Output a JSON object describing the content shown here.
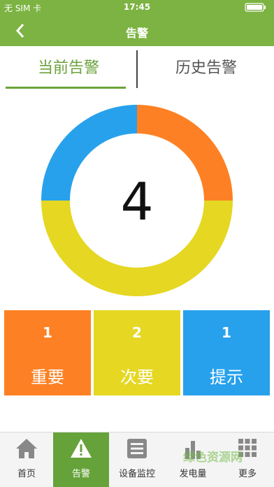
{
  "status_bar": {
    "carrier": "无 SIM 卡",
    "time": "17:45"
  },
  "header": {
    "back_icon": "chevron-left-icon",
    "title": "告警"
  },
  "tabs": [
    {
      "label": "当前告警",
      "active": true
    },
    {
      "label": "历史告警",
      "active": false
    }
  ],
  "summary": {
    "total": "4",
    "segments": [
      {
        "name": "重要",
        "value": 1,
        "color": "#fd8124"
      },
      {
        "name": "次要",
        "value": 2,
        "color": "#e5d722"
      },
      {
        "name": "提示",
        "value": 1,
        "color": "#27a1ec"
      }
    ]
  },
  "cards": [
    {
      "count": "1",
      "label": "重要",
      "color": "#fd8124"
    },
    {
      "count": "2",
      "label": "次要",
      "color": "#e5d722"
    },
    {
      "count": "1",
      "label": "提示",
      "color": "#27a1ec"
    }
  ],
  "tabbar": [
    {
      "label": "首页",
      "icon": "home-icon",
      "active": false
    },
    {
      "label": "告警",
      "icon": "warning-icon",
      "active": true
    },
    {
      "label": "设备监控",
      "icon": "list-icon",
      "active": false
    },
    {
      "label": "发电量",
      "icon": "bar-chart-icon",
      "active": false
    },
    {
      "label": "更多",
      "icon": "grid-icon",
      "active": false
    }
  ],
  "watermark": "绿色资源网"
}
